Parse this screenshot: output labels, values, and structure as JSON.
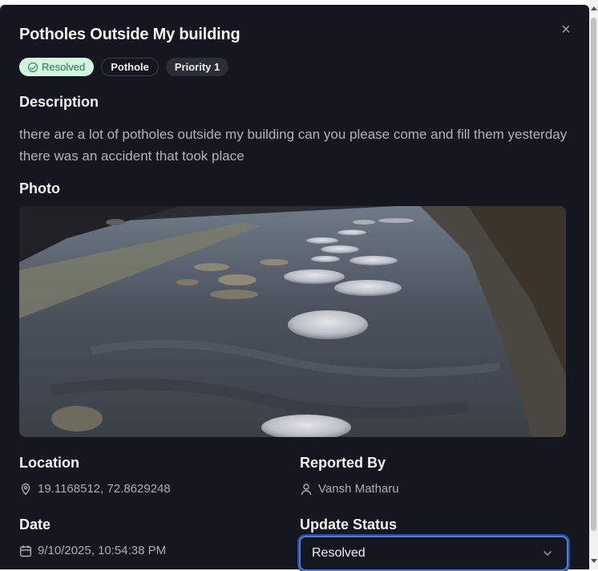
{
  "modal": {
    "title": "Potholes Outside My building",
    "close_icon": "×"
  },
  "badges": {
    "status": "Resolved",
    "category": "Pothole",
    "priority": "Priority 1"
  },
  "description": {
    "heading": "Description",
    "text": "there are a lot of potholes outside my building can you please come and fill them yesterday there was an accident that took place"
  },
  "photo": {
    "heading": "Photo"
  },
  "location": {
    "heading": "Location",
    "value": "19.1168512, 72.8629248"
  },
  "reported_by": {
    "heading": "Reported By",
    "value": "Vansh Matharu"
  },
  "date": {
    "heading": "Date",
    "value": "9/10/2025, 10:54:38 PM"
  },
  "update_status": {
    "heading": "Update Status",
    "selected": "Resolved"
  },
  "colors": {
    "modal_bg": "#14171f",
    "resolved_badge_bg": "#d4f5df",
    "resolved_badge_text": "#1f7a45",
    "focus_ring": "#4a7ddb"
  }
}
